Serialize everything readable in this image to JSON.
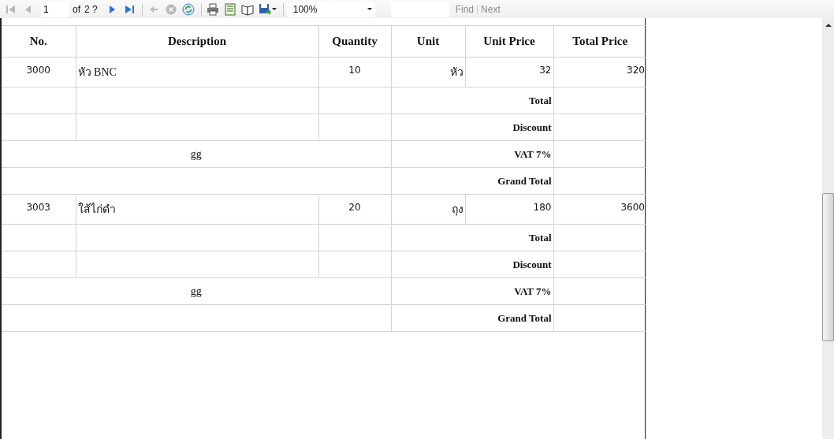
{
  "toolbar": {
    "nav_buttons": [
      {
        "kind": "first",
        "disabled": true
      },
      {
        "kind": "prev",
        "disabled": true
      }
    ],
    "page_field": {
      "value": "1"
    },
    "page_of": "of",
    "page_total": "2 ?",
    "nav_buttons_after": [
      {
        "kind": "next",
        "disabled": false
      },
      {
        "kind": "last",
        "disabled": false
      },
      {
        "kind": "back",
        "disabled": true
      },
      {
        "kind": "stop",
        "disabled": true
      },
      {
        "kind": "refresh",
        "disabled": false
      },
      {
        "kind": "print",
        "disabled": false
      },
      {
        "kind": "layout",
        "disabled": false
      },
      {
        "kind": "setup",
        "disabled": false
      },
      {
        "kind": "export",
        "disabled": false
      }
    ],
    "zoom": {
      "value": "100%"
    },
    "find_links": [
      {
        "label": "Find",
        "disabled": true
      },
      {
        "label": "Next",
        "disabled": true
      }
    ]
  },
  "table": {
    "columns": [
      "No.",
      "Description",
      "Quantity",
      "Unit",
      "Unit Price",
      "Total Price"
    ],
    "groups": [
      {
        "item": {
          "no": "3000",
          "description": "หัว BNC",
          "quantity": "10",
          "unit": "หัว",
          "unit_price": "32",
          "total_price": "320"
        },
        "total_label": "Total",
        "discount_label": "Discount",
        "note": "gg",
        "vat_label": "VAT 7%",
        "grand_total_label": "Grand Total"
      },
      {
        "item": {
          "no": "3003",
          "description": "ใส้ไก่ดำ",
          "quantity": "20",
          "unit": "ถุง",
          "unit_price": "180",
          "total_price": "3600"
        },
        "total_label": "Total",
        "discount_label": "Discount",
        "note": "gg",
        "vat_label": "VAT 7%",
        "grand_total_label": "Grand Total"
      }
    ]
  }
}
